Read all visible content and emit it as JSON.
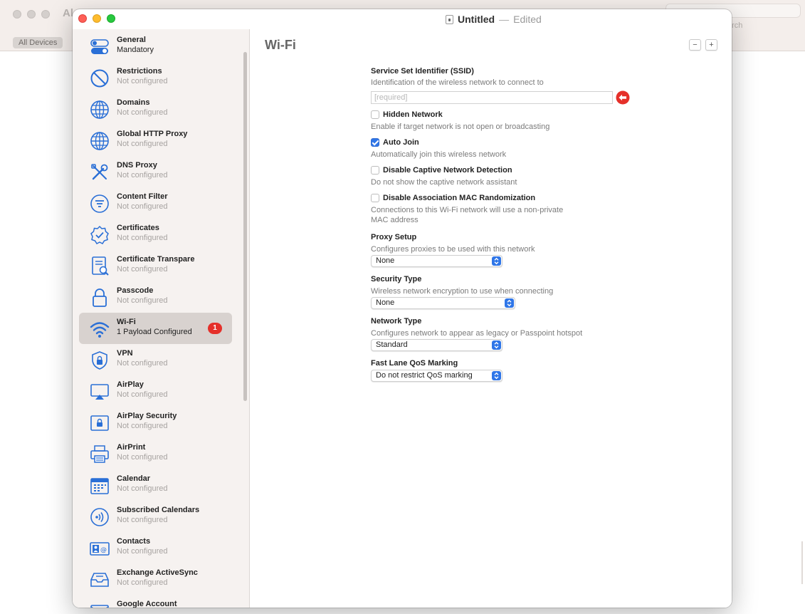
{
  "background": {
    "title": "Al",
    "search_placeholder": "Search",
    "search_label": "arch",
    "devices_button": "All Devices"
  },
  "window": {
    "title": "Untitled",
    "separator": "—",
    "status": "Edited"
  },
  "sidebar": {
    "items": [
      {
        "title": "General",
        "subtitle": "Mandatory",
        "icon": "general-toggle-icon"
      },
      {
        "title": "Restrictions",
        "subtitle": "Not configured",
        "icon": "restrictions-icon"
      },
      {
        "title": "Domains",
        "subtitle": "Not configured",
        "icon": "globe-icon"
      },
      {
        "title": "Global HTTP Proxy",
        "subtitle": "Not configured",
        "icon": "proxy-globe-icon"
      },
      {
        "title": "DNS Proxy",
        "subtitle": "Not configured",
        "icon": "tools-icon"
      },
      {
        "title": "Content Filter",
        "subtitle": "Not configured",
        "icon": "filter-icon"
      },
      {
        "title": "Certificates",
        "subtitle": "Not configured",
        "icon": "certificate-icon"
      },
      {
        "title": "Certificate Transpare",
        "subtitle": "Not configured",
        "icon": "certificate-transparency-icon"
      },
      {
        "title": "Passcode",
        "subtitle": "Not configured",
        "icon": "lock-icon"
      },
      {
        "title": "Wi-Fi",
        "subtitle": "1 Payload Configured",
        "icon": "wifi-icon",
        "badge": "1",
        "selected": true
      },
      {
        "title": "VPN",
        "subtitle": "Not configured",
        "icon": "vpn-icon"
      },
      {
        "title": "AirPlay",
        "subtitle": "Not configured",
        "icon": "airplay-icon"
      },
      {
        "title": "AirPlay Security",
        "subtitle": "Not configured",
        "icon": "airplay-security-icon"
      },
      {
        "title": "AirPrint",
        "subtitle": "Not configured",
        "icon": "printer-icon"
      },
      {
        "title": "Calendar",
        "subtitle": "Not configured",
        "icon": "calendar-icon"
      },
      {
        "title": "Subscribed Calendars",
        "subtitle": "Not configured",
        "icon": "subscribed-calendar-icon"
      },
      {
        "title": "Contacts",
        "subtitle": "Not configured",
        "icon": "contacts-icon"
      },
      {
        "title": "Exchange ActiveSync",
        "subtitle": "Not configured",
        "icon": "exchange-icon"
      },
      {
        "title": "Google Account",
        "subtitle": "",
        "icon": "google-account-icon"
      }
    ]
  },
  "content": {
    "title": "Wi-Fi",
    "remove_label": "−",
    "add_label": "+",
    "ssid": {
      "label": "Service Set Identifier (SSID)",
      "description": "Identification of the wireless network to connect to",
      "placeholder": "[required]"
    },
    "hidden_network": {
      "label": "Hidden Network",
      "description": "Enable if target network is not open or broadcasting",
      "checked": false
    },
    "auto_join": {
      "label": "Auto Join",
      "description": "Automatically join this wireless network",
      "checked": true
    },
    "captive": {
      "label": "Disable Captive Network Detection",
      "description": "Do not show the captive network assistant",
      "checked": false
    },
    "mac_random": {
      "label": "Disable Association MAC Randomization",
      "description_line1": "Connections to this Wi-Fi network will use a non-private",
      "description_line2": "MAC address",
      "checked": false
    },
    "proxy": {
      "label": "Proxy Setup",
      "description": "Configures proxies to be used with this network",
      "value": "None"
    },
    "security": {
      "label": "Security Type",
      "description": "Wireless network encryption to use when connecting",
      "value": "None"
    },
    "network_type": {
      "label": "Network Type",
      "description": "Configures network to appear as legacy or Passpoint hotspot",
      "value": "Standard"
    },
    "qos": {
      "label": "Fast Lane QoS Marking",
      "value": "Do not restrict QoS marking"
    }
  },
  "colors": {
    "accent": "#2f76e8",
    "badge": "#e5302a",
    "warning": "#e5302a",
    "icon_blue": "#2a6fd6"
  }
}
